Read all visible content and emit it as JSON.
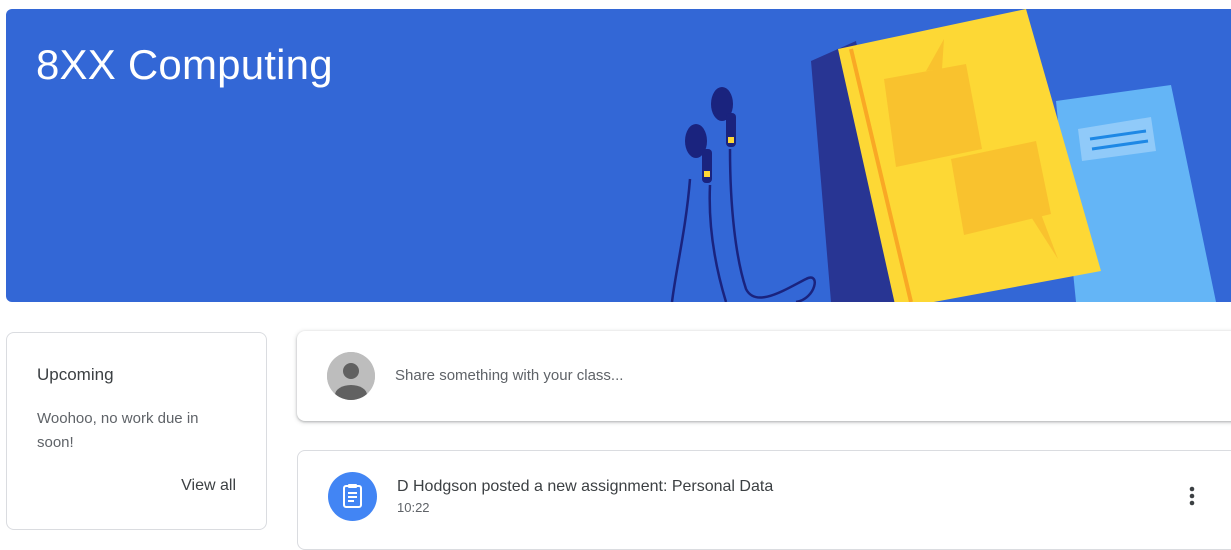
{
  "banner": {
    "title": "8XX Computing",
    "background_color": "#3367d6"
  },
  "upcoming": {
    "title": "Upcoming",
    "message": "Woohoo, no work due in soon!",
    "view_all_label": "View all"
  },
  "share": {
    "avatar_icon": "person-icon",
    "placeholder": "Share something with your class..."
  },
  "stream": {
    "posts": [
      {
        "icon": "assignment-icon",
        "icon_color": "#4285f4",
        "title": "D Hodgson posted a new assignment: Personal Data",
        "time": "10:22",
        "menu_icon": "more-vert-icon"
      }
    ]
  }
}
